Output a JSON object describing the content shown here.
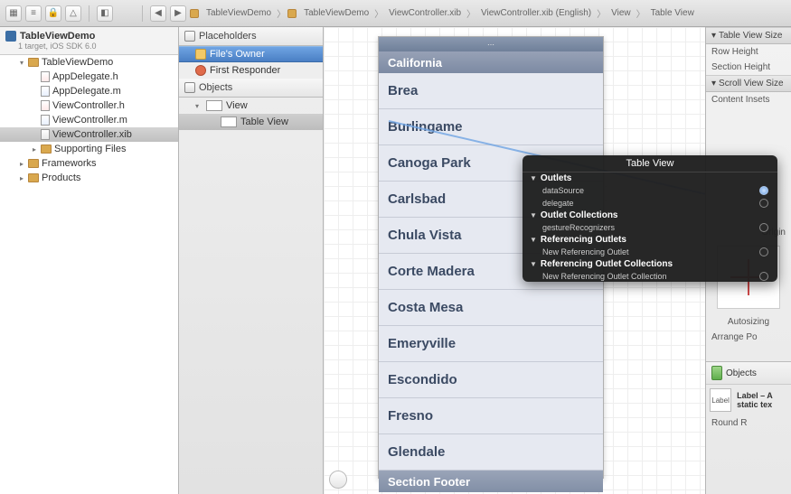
{
  "toolbar": {
    "icons": [
      "grid",
      "list",
      "lock",
      "warning",
      "tag"
    ],
    "nav_back": "◀",
    "nav_fwd": "▶"
  },
  "breadcrumb": {
    "items": [
      "TableViewDemo",
      "TableViewDemo",
      "ViewController.xib",
      "ViewController.xib (English)",
      "View",
      "Table View"
    ]
  },
  "navigator": {
    "project_name": "TableViewDemo",
    "project_subtitle": "1 target, iOS SDK 6.0",
    "tree": [
      {
        "label": "TableViewDemo",
        "type": "folder",
        "indent": 1,
        "open": true
      },
      {
        "label": "AppDelegate.h",
        "type": "h",
        "indent": 2
      },
      {
        "label": "AppDelegate.m",
        "type": "m",
        "indent": 2
      },
      {
        "label": "ViewController.h",
        "type": "h",
        "indent": 2
      },
      {
        "label": "ViewController.m",
        "type": "m",
        "indent": 2
      },
      {
        "label": "ViewController.xib",
        "type": "xib",
        "indent": 2,
        "selected": true
      },
      {
        "label": "Supporting Files",
        "type": "folder",
        "indent": 2
      },
      {
        "label": "Frameworks",
        "type": "folder",
        "indent": 1
      },
      {
        "label": "Products",
        "type": "folder",
        "indent": 1
      }
    ]
  },
  "outline": {
    "sections": {
      "placeholders": "Placeholders",
      "objects": "Objects"
    },
    "placeholders": [
      {
        "label": "File's Owner",
        "icon": "owner",
        "selected": true
      },
      {
        "label": "First Responder",
        "icon": "responder"
      }
    ],
    "objects": [
      {
        "label": "View",
        "icon": "view",
        "indent": 0,
        "open": true
      },
      {
        "label": "Table View",
        "icon": "view",
        "indent": 1,
        "selected_alt": true
      }
    ]
  },
  "simulator": {
    "section_header": "California",
    "rows": [
      "Brea",
      "Burlingame",
      "Canoga Park",
      "Carlsbad",
      "Chula Vista",
      "Corte Madera",
      "Costa Mesa",
      "Emeryville",
      "Escondido",
      "Fresno",
      "Glendale"
    ],
    "section_footer": "Section Footer"
  },
  "inspector": {
    "table_view_size_header": "Table View Size",
    "row_height_label": "Row Height",
    "section_height_label": "Section Height",
    "scroll_view_size_header": "Scroll View Size",
    "content_insets_label": "Content Insets",
    "origin_label": "Origin",
    "autosizing_label": "Autosizing",
    "arrange_label": "Arrange",
    "arrange_value": "Po",
    "objects_label": "Objects",
    "label_preview_name": "Label",
    "label_preview_desc": "Label – A static tex",
    "round_rect": "Round R"
  },
  "popover": {
    "title": "Table View",
    "sections": [
      {
        "heading": "Outlets",
        "rows": [
          {
            "label": "dataSource",
            "connected": true
          },
          {
            "label": "delegate",
            "connected": false
          }
        ]
      },
      {
        "heading": "Outlet Collections",
        "rows": [
          {
            "label": "gestureRecognizers",
            "connected": false
          }
        ]
      },
      {
        "heading": "Referencing Outlets",
        "rows": [
          {
            "label": "New Referencing Outlet",
            "connected": false
          }
        ]
      },
      {
        "heading": "Referencing Outlet Collections",
        "rows": [
          {
            "label": "New Referencing Outlet Collection",
            "connected": false
          }
        ]
      }
    ]
  }
}
